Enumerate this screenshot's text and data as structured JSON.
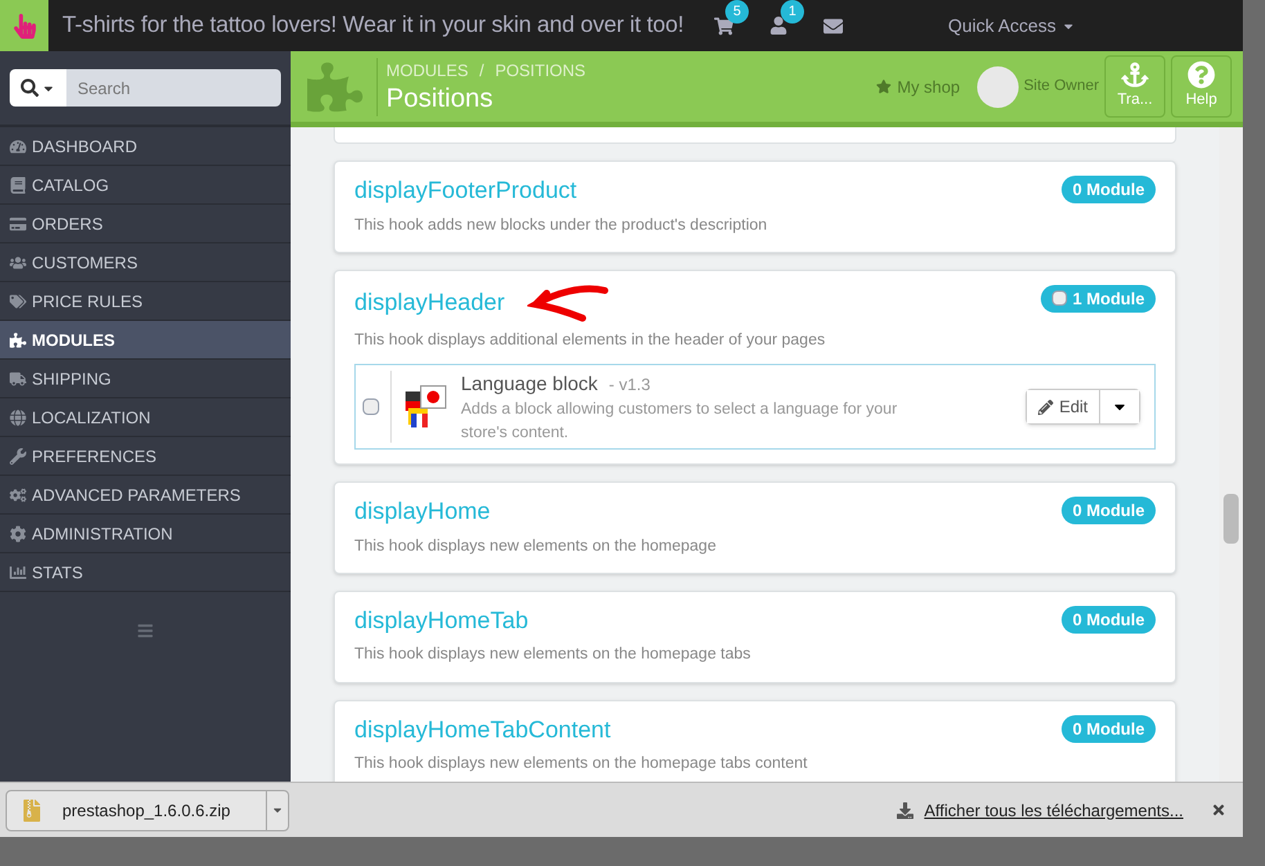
{
  "topbar": {
    "shop_title": "T-shirts for the tattoo lovers! Wear it in your skin and over it too!",
    "cart_count": "5",
    "customers_count": "1",
    "quick_access": "Quick Access"
  },
  "sidebar": {
    "search": {
      "placeholder": "Search"
    },
    "items": [
      {
        "label": "DASHBOARD",
        "selected": false
      },
      {
        "label": "CATALOG",
        "selected": false
      },
      {
        "label": "ORDERS",
        "selected": false
      },
      {
        "label": "CUSTOMERS",
        "selected": false
      },
      {
        "label": "PRICE RULES",
        "selected": false
      },
      {
        "label": "MODULES",
        "selected": true
      },
      {
        "label": "SHIPPING",
        "selected": false
      },
      {
        "label": "LOCALIZATION",
        "selected": false
      },
      {
        "label": "PREFERENCES",
        "selected": false
      },
      {
        "label": "ADVANCED PARAMETERS",
        "selected": false
      },
      {
        "label": "ADMINISTRATION",
        "selected": false
      },
      {
        "label": "STATS",
        "selected": false
      }
    ]
  },
  "header": {
    "breadcrumb": [
      "MODULES",
      "POSITIONS"
    ],
    "breadcrumb_separator": "/",
    "title": "Positions",
    "my_shop": "My shop",
    "user": "Site Owner",
    "buttons": [
      "Tra...",
      "Help"
    ]
  },
  "hooks": [
    {
      "name": "displayFooterProduct",
      "description": "This hook adds new blocks under the product's description",
      "count": "0 Module"
    },
    {
      "name": "displayHeader",
      "description": "This hook displays additional elements in the header of your pages",
      "count": "1 Module",
      "checked": false,
      "modules": [
        {
          "name": "Language block",
          "version": "- v1.3",
          "description": "Adds a block allowing customers to select a language for your store's content.",
          "checked": false,
          "action": "Edit"
        }
      ]
    },
    {
      "name": "displayHome",
      "description": "This hook displays new elements on the homepage",
      "count": "0 Module"
    },
    {
      "name": "displayHomeTab",
      "description": "This hook displays new elements on the homepage tabs",
      "count": "0 Module"
    },
    {
      "name": "displayHomeTabContent",
      "description": "This hook displays new elements on the homepage tabs content",
      "count": "0 Module"
    }
  ],
  "downloads": {
    "file": "prestashop_1.6.0.6.zip",
    "show_all": "Afficher tous les téléchargements..."
  }
}
